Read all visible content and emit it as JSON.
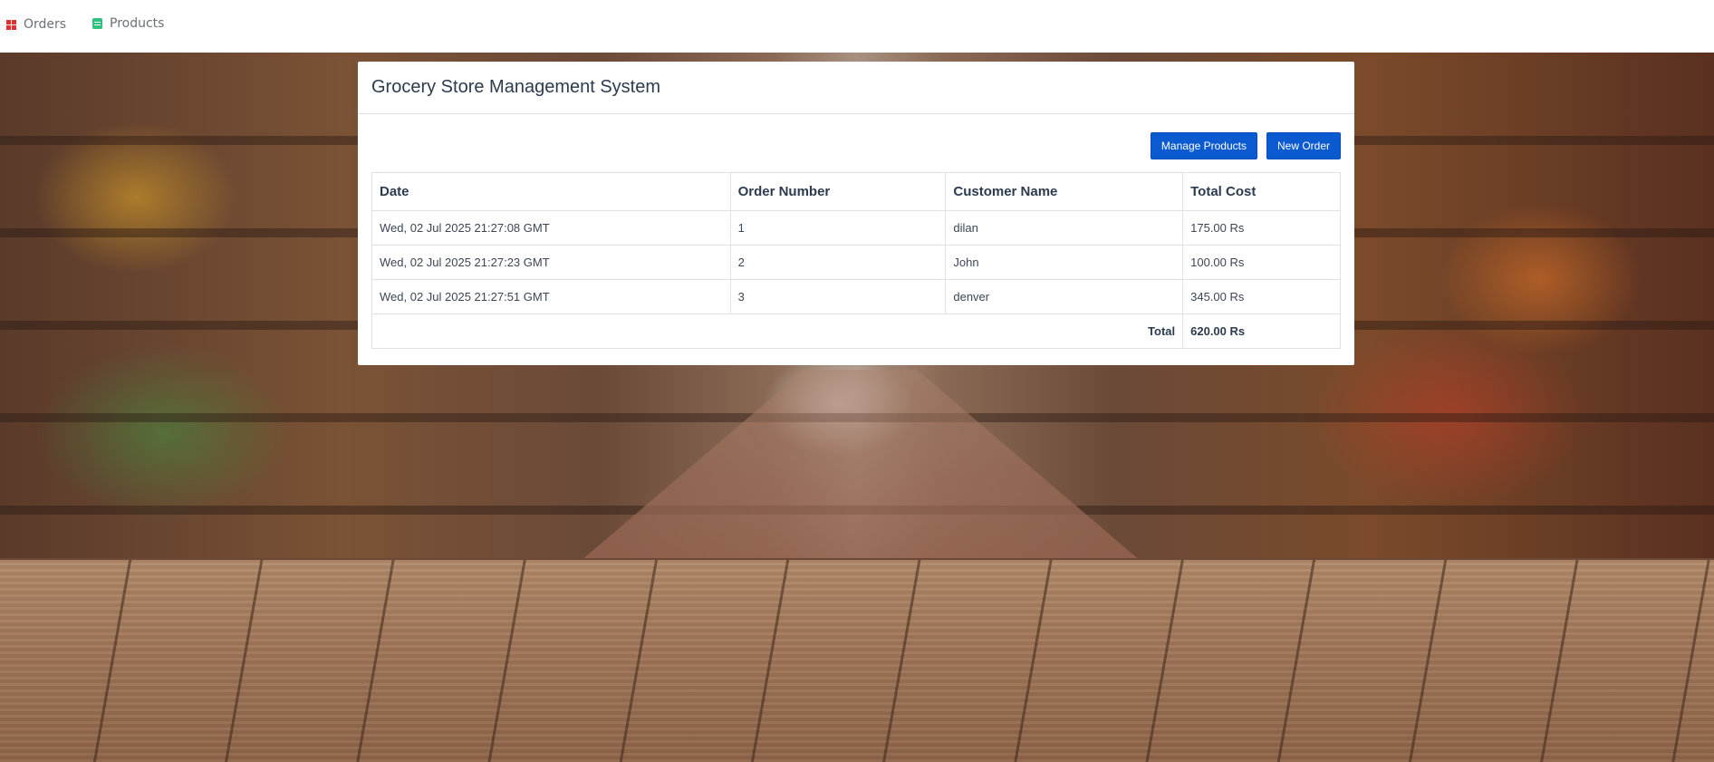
{
  "nav": {
    "items": [
      {
        "label": "Orders",
        "icon": "grid-icon",
        "color": "#e0312f"
      },
      {
        "label": "Products",
        "icon": "list-icon",
        "color": "#2fc27e"
      }
    ]
  },
  "card": {
    "title": "Grocery Store Management System",
    "buttons": {
      "manage_products": "Manage Products",
      "new_order": "New Order"
    },
    "table": {
      "headers": [
        "Date",
        "Order Number",
        "Customer Name",
        "Total Cost"
      ],
      "rows": [
        [
          "Wed, 02 Jul 2025 21:27:08 GMT",
          "1",
          "dilan",
          "175.00 Rs"
        ],
        [
          "Wed, 02 Jul 2025 21:27:23 GMT",
          "2",
          "John",
          "100.00 Rs"
        ],
        [
          "Wed, 02 Jul 2025 21:27:51 GMT",
          "3",
          "denver",
          "345.00 Rs"
        ]
      ],
      "total_label": "Total",
      "total_value": "620.00 Rs"
    }
  },
  "colors": {
    "accent": "#0b5ad0",
    "text_dark": "#2c3b4e"
  }
}
